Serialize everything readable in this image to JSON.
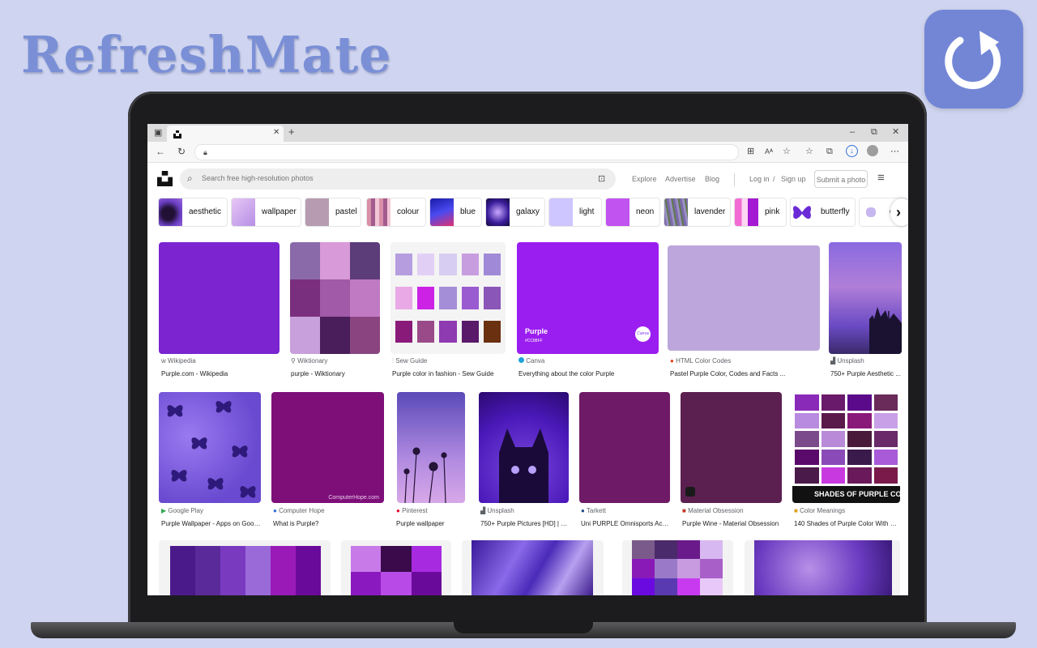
{
  "brand": {
    "title": "RefreshMate"
  },
  "browser": {
    "window_controls": [
      "–",
      "⧉",
      "✕"
    ]
  },
  "unsplash": {
    "search_placeholder": "Search free high-resolution photos",
    "nav": [
      "Explore",
      "Advertise",
      "Blog",
      "Log in",
      "/",
      "Sign up"
    ],
    "submit": "Submit a photo",
    "chips": [
      "aesthetic",
      "wallpaper",
      "pastel",
      "colour",
      "blue",
      "galaxy",
      "light",
      "neon",
      "lavender",
      "pink",
      "butterfly",
      "c"
    ]
  },
  "results": {
    "row1": [
      {
        "source": "Wikipedia",
        "title": "Purple.com - Wikipedia"
      },
      {
        "source": "Wiktionary",
        "title": "purple - Wiktionary"
      },
      {
        "source": "Sew Guide",
        "title": "Purple color in fashion - Sew Guide"
      },
      {
        "source": "Canva",
        "title": "Everything about the color Purple"
      },
      {
        "source": "HTML Color Codes",
        "title": "Pastel Purple Color, Codes and Facts ..."
      },
      {
        "source": "Unsplash",
        "title": "750+ Purple Aesthetic ..."
      }
    ],
    "row2": [
      {
        "source": "Google Play",
        "title": "Purple Wallpaper - Apps on Googl..."
      },
      {
        "source": "Computer Hope",
        "title": "What is Purple?"
      },
      {
        "source": "Pinterest",
        "title": "Purple wallpaper"
      },
      {
        "source": "Unsplash",
        "title": "750+ Purple Pictures [HD] | D..."
      },
      {
        "source": "Tarkett",
        "title": "Uni PURPLE Omnisports Activ..."
      },
      {
        "source": "Material Obsession",
        "title": "Purple Wine - Material Obsession"
      },
      {
        "source": "Color Meanings",
        "title": "140 Shades of Purple Color With Na..."
      }
    ],
    "canva_card": {
      "name": "Purple",
      "hex": "#CC88FF",
      "badge": "Canva"
    },
    "computerhope_watermark": "ComputerHope.com",
    "shades_banner": "SHADES OF PURPLE COLOR"
  },
  "colors": {
    "accent": "#7386d6",
    "purple": "#7b24d0",
    "brand_text": "#7a8fd6"
  }
}
